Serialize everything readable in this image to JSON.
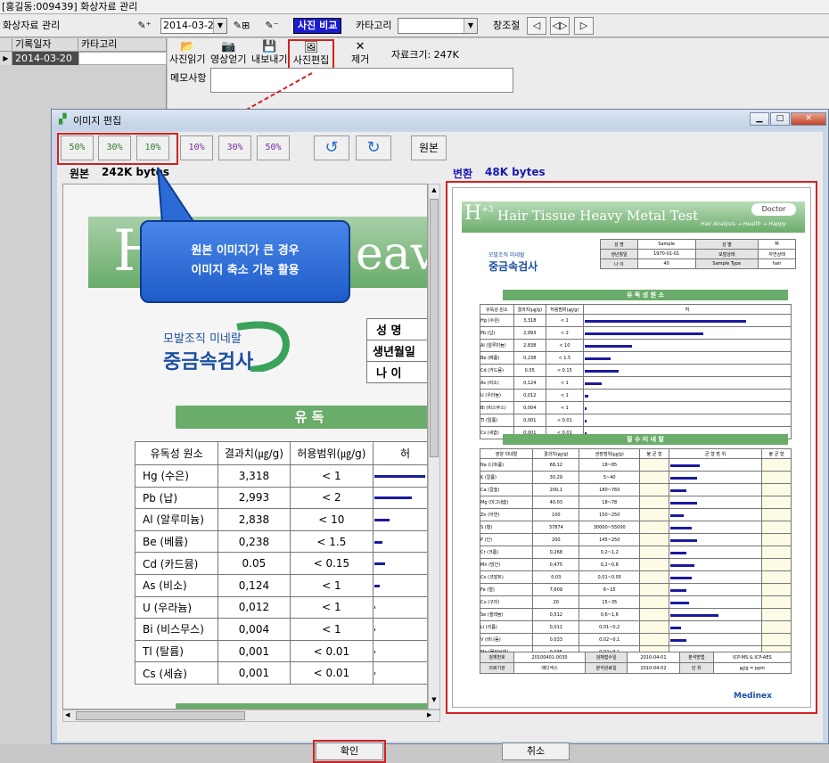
{
  "app": {
    "title": "[홍길동:009439] 화상자료 관리",
    "section": "화상자료 관리"
  },
  "toolbar": {
    "date": "2014-03-20",
    "compare_label": "사진 비교",
    "category_label": "카타고리",
    "category_value": "",
    "window_label": "창조절"
  },
  "grid": {
    "headers": [
      "기록일자",
      "카타고리"
    ],
    "rows": [
      {
        "date": "2014-03-20",
        "category": ""
      }
    ]
  },
  "detail": {
    "btn_photo_read": "사진읽기",
    "btn_video_read": "영상얻기",
    "btn_export": "내보내기",
    "btn_photo_edit": "사진편집",
    "btn_remove": "제거",
    "file_size": "자료크기: 247K",
    "memo_label": "메모사항",
    "memo_value": ""
  },
  "dialog": {
    "title": "이미지 편집",
    "zoom_down": [
      "50%",
      "30%",
      "10%"
    ],
    "zoom_up": [
      "10%",
      "30%",
      "50%"
    ],
    "original_btn": "원본",
    "orig_label": "원본",
    "orig_size": "242K bytes",
    "conv_label": "변환",
    "conv_size": "48K bytes",
    "ok": "확인",
    "cancel": "취소"
  },
  "callout": {
    "line1": "원본 이미지가 큰 경우",
    "line2": "이미지 축소 기능 활용"
  },
  "report": {
    "title": "Hair Tissue Heavy Metal Test",
    "subtitle": "Hair Analysis → Health → Happy",
    "badge": "Doctor",
    "logo_top": "모발조직 미네랄",
    "logo_main": "중금속검사",
    "info": [
      [
        "성 명",
        "Sample",
        "성 별",
        "M"
      ],
      [
        "생년월일",
        "1970-01-01",
        "모발상태",
        "자연상태"
      ],
      [
        "나 이",
        "40",
        "Sample Type",
        "hair"
      ]
    ],
    "info_labels_big": [
      "성 명",
      "생년월일",
      "나 이"
    ],
    "toxic_header": "유 독 성 원 소",
    "toxic_header_big": "유 독",
    "toxic_cols": [
      "유독성 원소",
      "결과치(㎍/g)",
      "허용범위(㎍/g)",
      "허"
    ],
    "toxic": [
      {
        "name": "Hg (수은)",
        "value": "3,318",
        "range": "< 1",
        "level": 0.95
      },
      {
        "name": "Pb (납)",
        "value": "2,993",
        "range": "< 2",
        "level": 0.7
      },
      {
        "name": "Al (알루미늄)",
        "value": "2,838",
        "range": "< 10",
        "level": 0.28
      },
      {
        "name": "Be (베륨)",
        "value": "0,238",
        "range": "< 1.5",
        "level": 0.15
      },
      {
        "name": "Cd (카드뮴)",
        "value": "0.05",
        "range": "< 0.15",
        "level": 0.2
      },
      {
        "name": "As (비소)",
        "value": "0,124",
        "range": "< 1",
        "level": 0.1
      },
      {
        "name": "U (우라늄)",
        "value": "0,012",
        "range": "< 1",
        "level": 0.02
      },
      {
        "name": "Bi (비스무스)",
        "value": "0,004",
        "range": "< 1",
        "level": 0.01
      },
      {
        "name": "Tl (탈륨)",
        "value": "0,001",
        "range": "< 0.01",
        "level": 0.01
      },
      {
        "name": "Cs (세슘)",
        "value": "0,001",
        "range": "< 0.01",
        "level": 0.01
      }
    ],
    "mineral_header": "필 수 미 네 랄",
    "mineral_cols": [
      "영양 미네랄",
      "결과치(㎍/g)",
      "권장범위(㎍/g)",
      "불 균 형",
      "균 형 범 위",
      "불 균 형"
    ],
    "minerals": [
      {
        "name": "Na (나트륨)",
        "value": "68,12",
        "range": "18~85",
        "level": 0.55
      },
      {
        "name": "K (칼륨)",
        "value": "30,29",
        "range": "5~40",
        "level": 0.5
      },
      {
        "name": "Ca (칼슘)",
        "value": "200,1",
        "range": "180~760",
        "level": 0.3
      },
      {
        "name": "Mg (마그네슘)",
        "value": "40,03",
        "range": "18~78",
        "level": 0.5
      },
      {
        "name": "Zn (아연)",
        "value": "100",
        "range": "150~250",
        "level": 0.25
      },
      {
        "name": "S (황)",
        "value": "37874",
        "range": "30000~55000",
        "level": 0.4
      },
      {
        "name": "P (인)",
        "value": "200",
        "range": "145~250",
        "level": 0.5
      },
      {
        "name": "Cr (크롬)",
        "value": "0,268",
        "range": "0,2~1,2",
        "level": 0.3
      },
      {
        "name": "Mn (망간)",
        "value": "0,475",
        "range": "0,2~0,8",
        "level": 0.45
      },
      {
        "name": "Co (코발트)",
        "value": "0,03",
        "range": "0,01~0,05",
        "level": 0.4
      },
      {
        "name": "Fe (철)",
        "value": "7,609",
        "range": "6~15",
        "level": 0.3
      },
      {
        "name": "Cu (구리)",
        "value": "20",
        "range": "15~35",
        "level": 0.35
      },
      {
        "name": "Se (셀레늄)",
        "value": "0,512",
        "range": "0,6~1,6",
        "level": 0.9
      },
      {
        "name": "Li (리튬)",
        "value": "0,011",
        "range": "0,01~0,2",
        "level": 0.2
      },
      {
        "name": "V (바나듐)",
        "value": "0,033",
        "range": "0,02~0,1",
        "level": 0.3
      },
      {
        "name": "Mo (몰리브덴)",
        "value": "0,035",
        "range": "0,02~0,1",
        "level": 0.3
      }
    ],
    "footer": [
      [
        "검체번호",
        "20100401-0030",
        "검체접수일",
        "2010-04-01",
        "분석방법",
        "ICP-MS & ICP-AES"
      ],
      [
        "의뢰기관",
        "매디넥스",
        "분석완료일",
        "2010-04-02",
        "단 위",
        "㎍/g = ppm"
      ]
    ],
    "brand": "Medinex"
  }
}
